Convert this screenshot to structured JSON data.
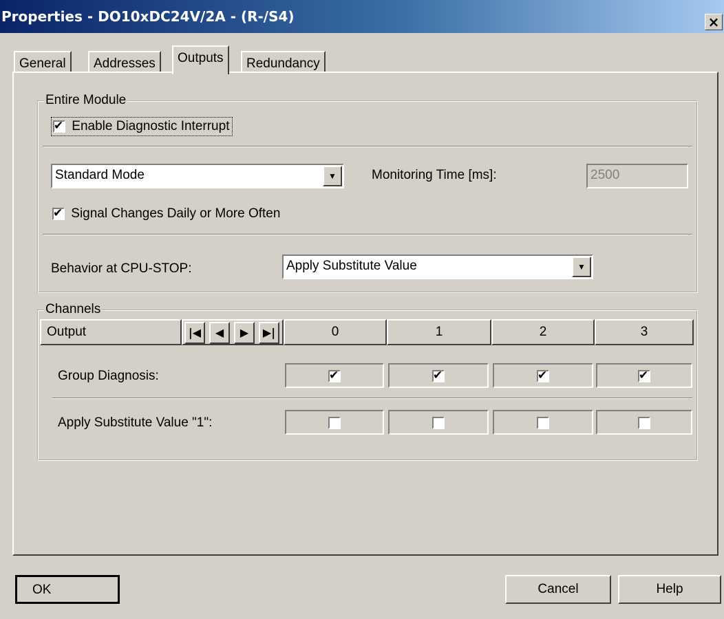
{
  "window": {
    "title": "Properties - DO10xDC24V/2A - (R-/S4)",
    "close_glyph": "×"
  },
  "tabs": [
    {
      "label": "General"
    },
    {
      "label": "Addresses"
    },
    {
      "label": "Outputs"
    },
    {
      "label": "Redundancy"
    }
  ],
  "active_tab": "Outputs",
  "entire_module": {
    "label": "Entire Module",
    "enable_diag_interrupt": {
      "label": "Enable Diagnostic Interrupt",
      "checked": true
    },
    "mode_select": {
      "value": "Standard Mode"
    },
    "monitoring_time": {
      "label": "Monitoring Time [ms]:",
      "value": "2500"
    },
    "signal_changes": {
      "label": "Signal Changes Daily or More Often",
      "checked": true
    },
    "behavior": {
      "label": "Behavior at CPU-STOP:",
      "value": "Apply Substitute Value"
    }
  },
  "channels": {
    "label": "Channels",
    "header_label": "Output",
    "nav_glyphs": {
      "first": "|◀",
      "prev": "◀",
      "next": "▶",
      "last": "▶|"
    },
    "columns": [
      "0",
      "1",
      "2",
      "3"
    ],
    "rows": [
      {
        "label": "Group Diagnosis:",
        "values": [
          true,
          true,
          true,
          true
        ]
      },
      {
        "label": "Apply Substitute Value \"1\":",
        "values": [
          false,
          false,
          false,
          false
        ]
      }
    ]
  },
  "buttons": {
    "ok": "OK",
    "cancel": "Cancel",
    "help": "Help"
  },
  "check_glyph": "✔"
}
